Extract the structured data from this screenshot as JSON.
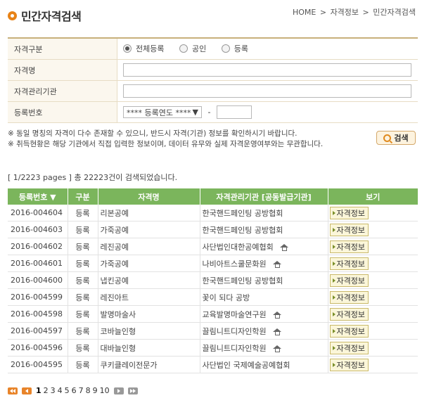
{
  "header": {
    "title": "민간자격검색",
    "breadcrumb": [
      "HOME",
      ">",
      "자격정보",
      ">",
      "민간자격검색"
    ]
  },
  "form": {
    "type_label": "자격구분",
    "radios": [
      {
        "label": "전체등록",
        "checked": true
      },
      {
        "label": "공인",
        "checked": false
      },
      {
        "label": "등록",
        "checked": false
      }
    ],
    "name_label": "자격명",
    "name_value": "",
    "org_label": "자격관리기관",
    "org_value": "",
    "reg_label": "등록번호",
    "reg_select": "**** 등록연도 ****",
    "reg_dash": "-",
    "reg_value": ""
  },
  "notes": [
    "※ 동일 명칭의 자격이 다수 존재할 수 있으니, 반드시 자격(기관) 정보를 확인하시기 바랍니다.",
    "※ 취득현황은 해당 기관에서 직접 입력한 정보이며, 데이터 유무와 실제 자격운영여부와는 무관합니다."
  ],
  "search_button": "검색",
  "result_count": "[ 1/2223 pages ] 총 22223건이 검색되었습니다.",
  "table": {
    "headers": [
      "등록번호 ▼",
      "구분",
      "자격명",
      "자격관리기관 [공동발급기관]",
      "보기"
    ],
    "rows": [
      {
        "no": "2016-004604",
        "type": "등록",
        "name": "리본공예",
        "org": "한국핸드페인팅 공방협회",
        "home": false,
        "view": "자격정보"
      },
      {
        "no": "2016-004603",
        "type": "등록",
        "name": "가죽공예",
        "org": "한국핸드페인팅 공방협회",
        "home": false,
        "view": "자격정보"
      },
      {
        "no": "2016-004602",
        "type": "등록",
        "name": "레진공예",
        "org": "사단법인대한공예협회",
        "home": true,
        "view": "자격정보"
      },
      {
        "no": "2016-004601",
        "type": "등록",
        "name": "가죽공예",
        "org": "나비아트스쿨문화원",
        "home": true,
        "view": "자격정보"
      },
      {
        "no": "2016-004600",
        "type": "등록",
        "name": "냅킨공예",
        "org": "한국핸드페인팅 공방협회",
        "home": false,
        "view": "자격정보"
      },
      {
        "no": "2016-004599",
        "type": "등록",
        "name": "레진아트",
        "org": "꽃이 되다 공방",
        "home": false,
        "view": "자격정보"
      },
      {
        "no": "2016-004598",
        "type": "등록",
        "name": "발명마술사",
        "org": "교육발명마술연구원",
        "home": true,
        "view": "자격정보"
      },
      {
        "no": "2016-004597",
        "type": "등록",
        "name": "코바늘인형",
        "org": "끌림니트디자인학원",
        "home": true,
        "view": "자격정보"
      },
      {
        "no": "2016-004596",
        "type": "등록",
        "name": "대바늘인형",
        "org": "끌림니트디자인학원",
        "home": true,
        "view": "자격정보"
      },
      {
        "no": "2016-004595",
        "type": "등록",
        "name": "쿠키클레이전문가",
        "org": "사단법인 국제예술공예협회",
        "home": false,
        "view": "자격정보"
      }
    ]
  },
  "pager": {
    "pages": [
      "1",
      "2",
      "3",
      "4",
      "5",
      "6",
      "7",
      "8",
      "9",
      "10"
    ],
    "current": "1"
  },
  "colors": {
    "accent": "#e88317",
    "table_header": "#7bb55c",
    "form_rule": "#c8b07b"
  }
}
